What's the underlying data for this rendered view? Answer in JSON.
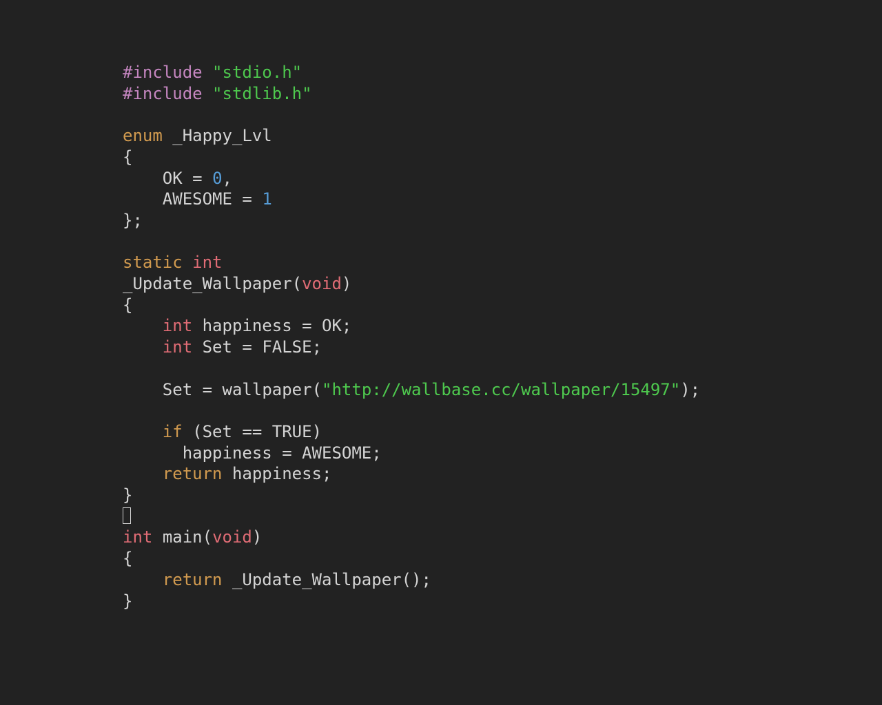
{
  "code": {
    "tokens": [
      {
        "cls": "tok-pre",
        "t": "#include"
      },
      {
        "cls": "tok-punc",
        "t": " "
      },
      {
        "cls": "tok-str",
        "t": "\"stdio.h\""
      },
      {
        "cls": "nl"
      },
      {
        "cls": "tok-pre",
        "t": "#include"
      },
      {
        "cls": "tok-punc",
        "t": " "
      },
      {
        "cls": "tok-str",
        "t": "\"stdlib.h\""
      },
      {
        "cls": "nl"
      },
      {
        "cls": "nl"
      },
      {
        "cls": "tok-kw",
        "t": "enum"
      },
      {
        "cls": "tok-punc",
        "t": " "
      },
      {
        "cls": "tok-ident",
        "t": "_Happy_Lvl"
      },
      {
        "cls": "nl"
      },
      {
        "cls": "tok-punc",
        "t": "{"
      },
      {
        "cls": "nl"
      },
      {
        "cls": "tok-punc",
        "t": "    "
      },
      {
        "cls": "tok-ident",
        "t": "OK"
      },
      {
        "cls": "tok-punc",
        "t": " = "
      },
      {
        "cls": "tok-num",
        "t": "0"
      },
      {
        "cls": "tok-punc",
        "t": ","
      },
      {
        "cls": "nl"
      },
      {
        "cls": "tok-punc",
        "t": "    "
      },
      {
        "cls": "tok-ident",
        "t": "AWESOME"
      },
      {
        "cls": "tok-punc",
        "t": " = "
      },
      {
        "cls": "tok-num",
        "t": "1"
      },
      {
        "cls": "nl"
      },
      {
        "cls": "tok-punc",
        "t": "};"
      },
      {
        "cls": "nl"
      },
      {
        "cls": "nl"
      },
      {
        "cls": "tok-kw",
        "t": "static"
      },
      {
        "cls": "tok-punc",
        "t": " "
      },
      {
        "cls": "tok-type",
        "t": "int"
      },
      {
        "cls": "nl"
      },
      {
        "cls": "tok-fn",
        "t": "_Update_Wallpaper"
      },
      {
        "cls": "tok-punc",
        "t": "("
      },
      {
        "cls": "tok-type",
        "t": "void"
      },
      {
        "cls": "tok-punc",
        "t": ")"
      },
      {
        "cls": "nl"
      },
      {
        "cls": "tok-punc",
        "t": "{"
      },
      {
        "cls": "nl"
      },
      {
        "cls": "tok-punc",
        "t": "    "
      },
      {
        "cls": "tok-type",
        "t": "int"
      },
      {
        "cls": "tok-punc",
        "t": " "
      },
      {
        "cls": "tok-ident",
        "t": "happiness"
      },
      {
        "cls": "tok-punc",
        "t": " = "
      },
      {
        "cls": "tok-ident",
        "t": "OK"
      },
      {
        "cls": "tok-punc",
        "t": ";"
      },
      {
        "cls": "nl"
      },
      {
        "cls": "tok-punc",
        "t": "    "
      },
      {
        "cls": "tok-type",
        "t": "int"
      },
      {
        "cls": "tok-punc",
        "t": " "
      },
      {
        "cls": "tok-ident",
        "t": "Set"
      },
      {
        "cls": "tok-punc",
        "t": " = "
      },
      {
        "cls": "tok-ident",
        "t": "FALSE"
      },
      {
        "cls": "tok-punc",
        "t": ";"
      },
      {
        "cls": "nl"
      },
      {
        "cls": "nl"
      },
      {
        "cls": "tok-punc",
        "t": "    "
      },
      {
        "cls": "tok-ident",
        "t": "Set"
      },
      {
        "cls": "tok-punc",
        "t": " = "
      },
      {
        "cls": "tok-fn",
        "t": "wallpaper"
      },
      {
        "cls": "tok-punc",
        "t": "("
      },
      {
        "cls": "tok-str",
        "t": "\"http://wallbase.cc/wallpaper/15497\""
      },
      {
        "cls": "tok-punc",
        "t": ");"
      },
      {
        "cls": "nl"
      },
      {
        "cls": "nl"
      },
      {
        "cls": "tok-punc",
        "t": "    "
      },
      {
        "cls": "tok-kw",
        "t": "if"
      },
      {
        "cls": "tok-punc",
        "t": " ("
      },
      {
        "cls": "tok-ident",
        "t": "Set"
      },
      {
        "cls": "tok-punc",
        "t": " == "
      },
      {
        "cls": "tok-ident",
        "t": "TRUE"
      },
      {
        "cls": "tok-punc",
        "t": ")"
      },
      {
        "cls": "nl"
      },
      {
        "cls": "tok-punc",
        "t": "      "
      },
      {
        "cls": "tok-ident",
        "t": "happiness"
      },
      {
        "cls": "tok-punc",
        "t": " = "
      },
      {
        "cls": "tok-ident",
        "t": "AWESOME"
      },
      {
        "cls": "tok-punc",
        "t": ";"
      },
      {
        "cls": "nl"
      },
      {
        "cls": "tok-punc",
        "t": "    "
      },
      {
        "cls": "tok-kw",
        "t": "return"
      },
      {
        "cls": "tok-punc",
        "t": " "
      },
      {
        "cls": "tok-ident",
        "t": "happiness"
      },
      {
        "cls": "tok-punc",
        "t": ";"
      },
      {
        "cls": "nl"
      },
      {
        "cls": "tok-punc",
        "t": "}"
      },
      {
        "cls": "nl"
      },
      {
        "cls": "box"
      },
      {
        "cls": "nl"
      },
      {
        "cls": "tok-type",
        "t": "int"
      },
      {
        "cls": "tok-punc",
        "t": " "
      },
      {
        "cls": "tok-fn",
        "t": "main"
      },
      {
        "cls": "tok-punc",
        "t": "("
      },
      {
        "cls": "tok-type",
        "t": "void"
      },
      {
        "cls": "tok-punc",
        "t": ")"
      },
      {
        "cls": "nl"
      },
      {
        "cls": "tok-punc",
        "t": "{"
      },
      {
        "cls": "nl"
      },
      {
        "cls": "tok-punc",
        "t": "    "
      },
      {
        "cls": "tok-kw",
        "t": "return"
      },
      {
        "cls": "tok-punc",
        "t": " "
      },
      {
        "cls": "tok-fn",
        "t": "_Update_Wallpaper"
      },
      {
        "cls": "tok-punc",
        "t": "();"
      },
      {
        "cls": "nl"
      },
      {
        "cls": "tok-punc",
        "t": "}"
      },
      {
        "cls": "nl"
      }
    ]
  }
}
